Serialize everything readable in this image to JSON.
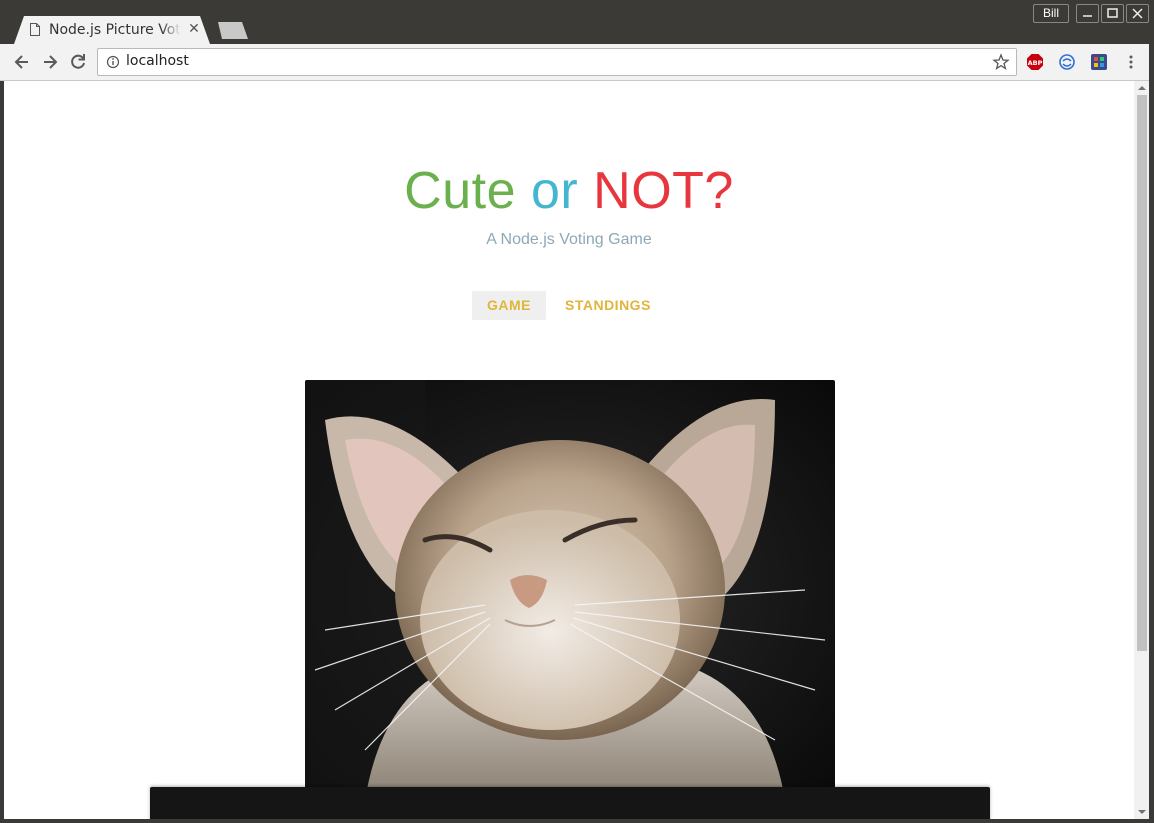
{
  "browser": {
    "tab_title": "Node.js Picture Voting Game",
    "tab_close": "✕",
    "profile_name": "Bill",
    "window_buttons": {
      "minimize": "–",
      "maximize": "□",
      "close": "✕"
    },
    "url": "localhost",
    "icons": [
      "page-icon",
      "back-icon",
      "forward-icon",
      "reload-icon",
      "info-icon",
      "star-icon",
      "adblock-plus-icon",
      "sync-extension-icon",
      "color-extension-icon",
      "menu-icon"
    ]
  },
  "page": {
    "title_parts": {
      "cute": "Cute",
      "or": "or",
      "not": "NOT?"
    },
    "subtitle": "A Node.js Voting Game",
    "nav": {
      "game": "GAME",
      "standings": "STANDINGS"
    },
    "photo_subject": "kitten"
  },
  "colors": {
    "cute": "#6ab04c",
    "or": "#45b6d0",
    "not": "#e8363f",
    "nav_text": "#e0b53a",
    "subtitle": "#8fa8b6"
  }
}
